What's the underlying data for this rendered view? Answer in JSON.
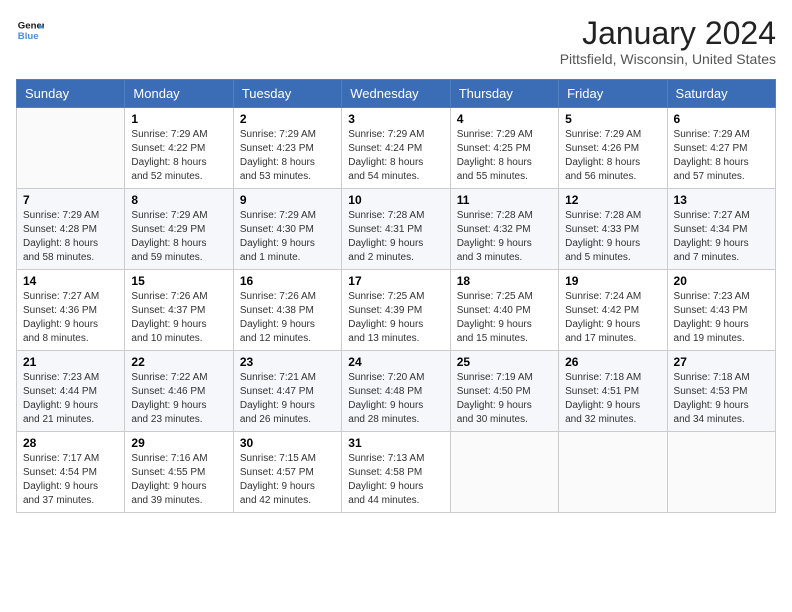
{
  "header": {
    "logo_line1": "General",
    "logo_line2": "Blue",
    "month_title": "January 2024",
    "location": "Pittsfield, Wisconsin, United States"
  },
  "weekdays": [
    "Sunday",
    "Monday",
    "Tuesday",
    "Wednesday",
    "Thursday",
    "Friday",
    "Saturday"
  ],
  "weeks": [
    [
      {
        "day": "",
        "info": ""
      },
      {
        "day": "1",
        "info": "Sunrise: 7:29 AM\nSunset: 4:22 PM\nDaylight: 8 hours\nand 52 minutes."
      },
      {
        "day": "2",
        "info": "Sunrise: 7:29 AM\nSunset: 4:23 PM\nDaylight: 8 hours\nand 53 minutes."
      },
      {
        "day": "3",
        "info": "Sunrise: 7:29 AM\nSunset: 4:24 PM\nDaylight: 8 hours\nand 54 minutes."
      },
      {
        "day": "4",
        "info": "Sunrise: 7:29 AM\nSunset: 4:25 PM\nDaylight: 8 hours\nand 55 minutes."
      },
      {
        "day": "5",
        "info": "Sunrise: 7:29 AM\nSunset: 4:26 PM\nDaylight: 8 hours\nand 56 minutes."
      },
      {
        "day": "6",
        "info": "Sunrise: 7:29 AM\nSunset: 4:27 PM\nDaylight: 8 hours\nand 57 minutes."
      }
    ],
    [
      {
        "day": "7",
        "info": "Sunrise: 7:29 AM\nSunset: 4:28 PM\nDaylight: 8 hours\nand 58 minutes."
      },
      {
        "day": "8",
        "info": "Sunrise: 7:29 AM\nSunset: 4:29 PM\nDaylight: 8 hours\nand 59 minutes."
      },
      {
        "day": "9",
        "info": "Sunrise: 7:29 AM\nSunset: 4:30 PM\nDaylight: 9 hours\nand 1 minute."
      },
      {
        "day": "10",
        "info": "Sunrise: 7:28 AM\nSunset: 4:31 PM\nDaylight: 9 hours\nand 2 minutes."
      },
      {
        "day": "11",
        "info": "Sunrise: 7:28 AM\nSunset: 4:32 PM\nDaylight: 9 hours\nand 3 minutes."
      },
      {
        "day": "12",
        "info": "Sunrise: 7:28 AM\nSunset: 4:33 PM\nDaylight: 9 hours\nand 5 minutes."
      },
      {
        "day": "13",
        "info": "Sunrise: 7:27 AM\nSunset: 4:34 PM\nDaylight: 9 hours\nand 7 minutes."
      }
    ],
    [
      {
        "day": "14",
        "info": "Sunrise: 7:27 AM\nSunset: 4:36 PM\nDaylight: 9 hours\nand 8 minutes."
      },
      {
        "day": "15",
        "info": "Sunrise: 7:26 AM\nSunset: 4:37 PM\nDaylight: 9 hours\nand 10 minutes."
      },
      {
        "day": "16",
        "info": "Sunrise: 7:26 AM\nSunset: 4:38 PM\nDaylight: 9 hours\nand 12 minutes."
      },
      {
        "day": "17",
        "info": "Sunrise: 7:25 AM\nSunset: 4:39 PM\nDaylight: 9 hours\nand 13 minutes."
      },
      {
        "day": "18",
        "info": "Sunrise: 7:25 AM\nSunset: 4:40 PM\nDaylight: 9 hours\nand 15 minutes."
      },
      {
        "day": "19",
        "info": "Sunrise: 7:24 AM\nSunset: 4:42 PM\nDaylight: 9 hours\nand 17 minutes."
      },
      {
        "day": "20",
        "info": "Sunrise: 7:23 AM\nSunset: 4:43 PM\nDaylight: 9 hours\nand 19 minutes."
      }
    ],
    [
      {
        "day": "21",
        "info": "Sunrise: 7:23 AM\nSunset: 4:44 PM\nDaylight: 9 hours\nand 21 minutes."
      },
      {
        "day": "22",
        "info": "Sunrise: 7:22 AM\nSunset: 4:46 PM\nDaylight: 9 hours\nand 23 minutes."
      },
      {
        "day": "23",
        "info": "Sunrise: 7:21 AM\nSunset: 4:47 PM\nDaylight: 9 hours\nand 26 minutes."
      },
      {
        "day": "24",
        "info": "Sunrise: 7:20 AM\nSunset: 4:48 PM\nDaylight: 9 hours\nand 28 minutes."
      },
      {
        "day": "25",
        "info": "Sunrise: 7:19 AM\nSunset: 4:50 PM\nDaylight: 9 hours\nand 30 minutes."
      },
      {
        "day": "26",
        "info": "Sunrise: 7:18 AM\nSunset: 4:51 PM\nDaylight: 9 hours\nand 32 minutes."
      },
      {
        "day": "27",
        "info": "Sunrise: 7:18 AM\nSunset: 4:53 PM\nDaylight: 9 hours\nand 34 minutes."
      }
    ],
    [
      {
        "day": "28",
        "info": "Sunrise: 7:17 AM\nSunset: 4:54 PM\nDaylight: 9 hours\nand 37 minutes."
      },
      {
        "day": "29",
        "info": "Sunrise: 7:16 AM\nSunset: 4:55 PM\nDaylight: 9 hours\nand 39 minutes."
      },
      {
        "day": "30",
        "info": "Sunrise: 7:15 AM\nSunset: 4:57 PM\nDaylight: 9 hours\nand 42 minutes."
      },
      {
        "day": "31",
        "info": "Sunrise: 7:13 AM\nSunset: 4:58 PM\nDaylight: 9 hours\nand 44 minutes."
      },
      {
        "day": "",
        "info": ""
      },
      {
        "day": "",
        "info": ""
      },
      {
        "day": "",
        "info": ""
      }
    ]
  ]
}
